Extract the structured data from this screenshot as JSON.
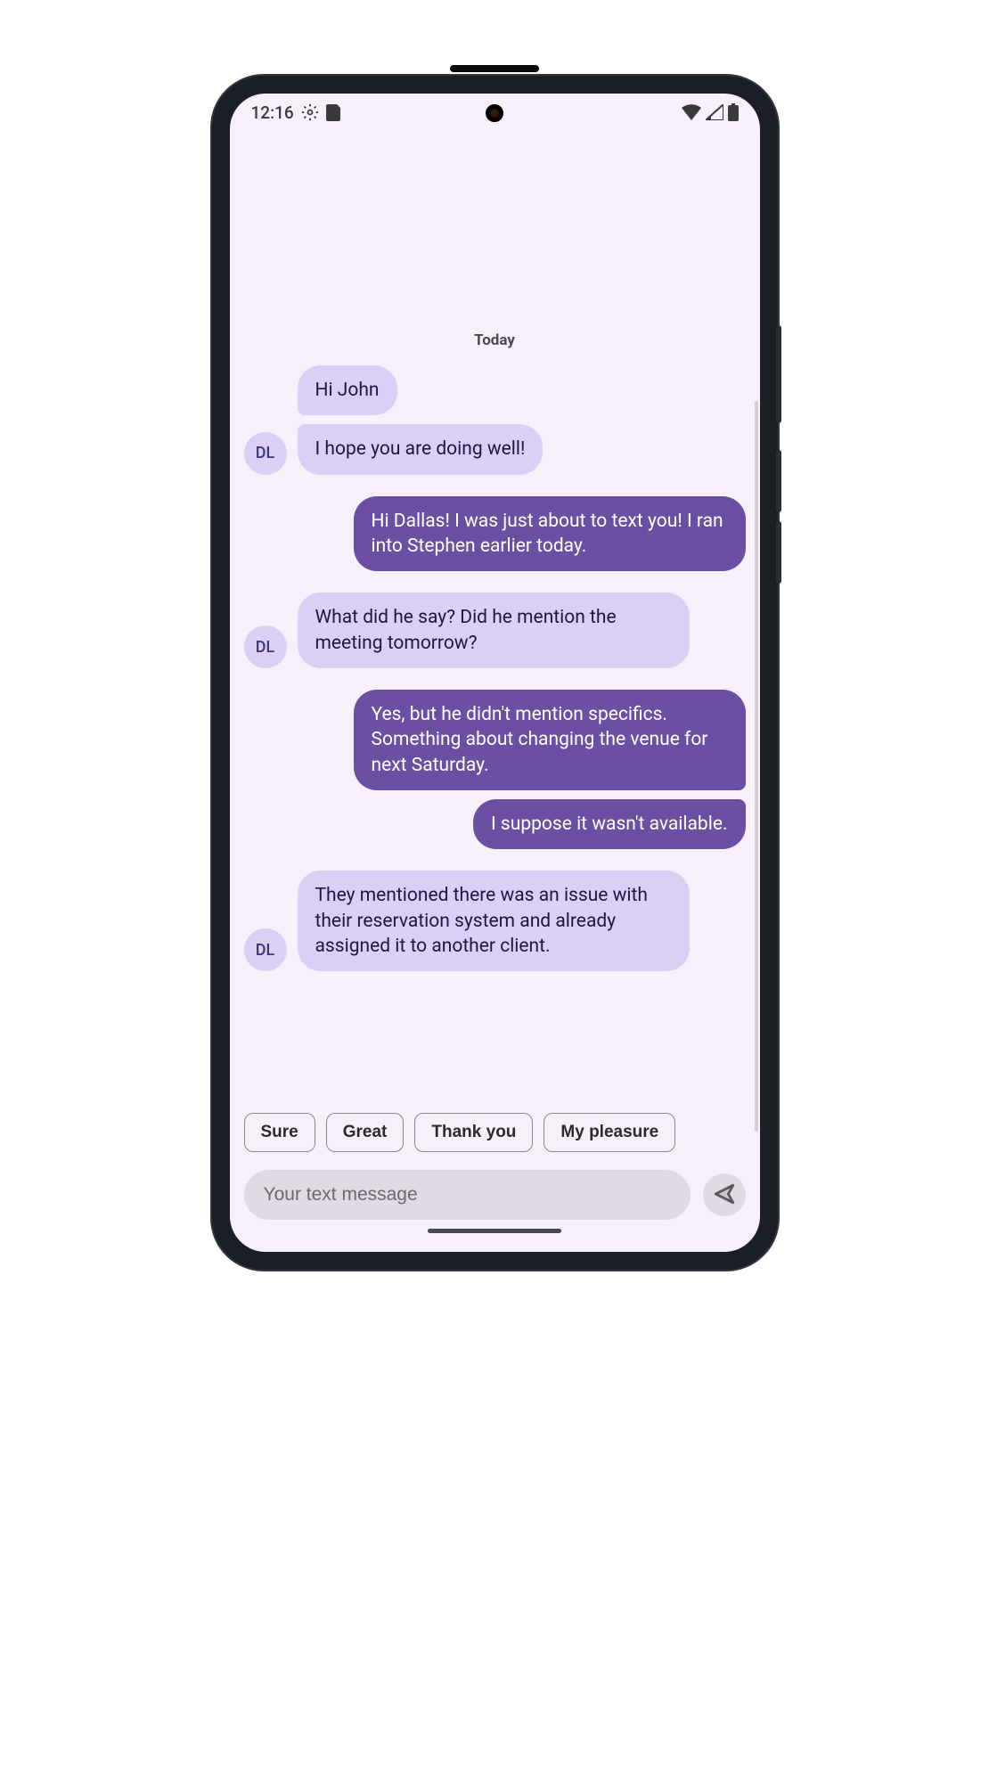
{
  "status_bar": {
    "time": "12:16"
  },
  "conversation": {
    "date_label": "Today",
    "contact_initials": "DL",
    "messages": [
      {
        "text": "Hi John",
        "sender": "incoming"
      },
      {
        "text": "I hope you are doing well!",
        "sender": "incoming"
      },
      {
        "text": "Hi Dallas! I was just about to text you! I ran into Stephen earlier today.",
        "sender": "outgoing"
      },
      {
        "text": "What did he say? Did he mention the meeting tomorrow?",
        "sender": "incoming"
      },
      {
        "text": "Yes, but he didn't mention specifics. Something about changing the venue for next Saturday.",
        "sender": "outgoing"
      },
      {
        "text": "I suppose it wasn't available.",
        "sender": "outgoing"
      },
      {
        "text": "They mentioned there was an issue with their reservation system and already assigned it to another client.",
        "sender": "incoming"
      }
    ]
  },
  "suggestions": [
    "Sure",
    "Great",
    "Thank you",
    "My pleasure"
  ],
  "input": {
    "placeholder": "Your text message"
  }
}
